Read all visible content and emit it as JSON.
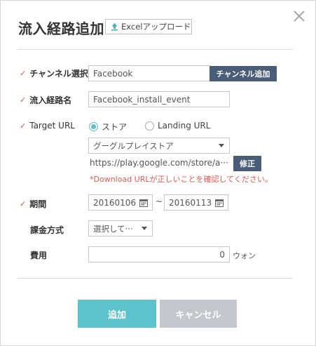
{
  "dialog": {
    "title": "流入経路追加",
    "upload_label": "Excelアップロード"
  },
  "form": {
    "channel": {
      "label": "チャンネル選択",
      "value": "Facebook",
      "add_button": "チャンネル追加"
    },
    "route_name": {
      "label": "流入経路名",
      "value": "Facebook_install_event"
    },
    "target_url": {
      "label": "Target URL",
      "radio_store": "ストア",
      "radio_landing": "Landing URL",
      "selected": "ストア",
      "store_select": "グーグルプレイストア",
      "url_text": "https://play.google.com/store/a···",
      "edit_button": "修正",
      "warning": "*Download URLが正しいことを確認してください。"
    },
    "period": {
      "label": "期間",
      "start": "20160106",
      "separator": "~",
      "end": "20160113"
    },
    "billing": {
      "label": "課金方式",
      "value": "選択して···"
    },
    "cost": {
      "label": "費用",
      "value": "0",
      "unit": "ウォン"
    }
  },
  "actions": {
    "add": "追加",
    "cancel": "キャンセル"
  },
  "colors": {
    "accent": "#5cc3cd",
    "dark_button": "#4a5d78",
    "required_mark": "#d9534f",
    "warning": "#e05a4f",
    "cancel": "#c4c8cd"
  },
  "icons": [
    "upload-icon",
    "close-icon",
    "checkmark-icon",
    "calendar-icon",
    "chevron-down-icon"
  ]
}
